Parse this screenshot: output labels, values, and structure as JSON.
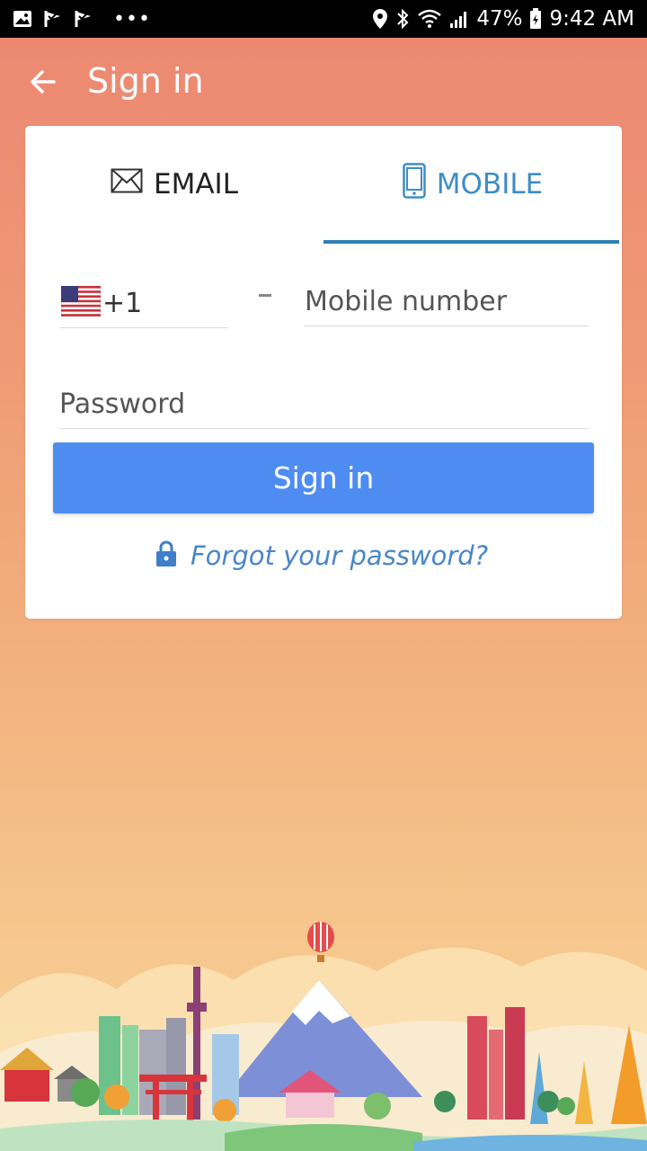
{
  "status_bar": {
    "battery": "47%",
    "time": "9:42 AM",
    "icons": [
      "image-icon",
      "check-flag-icon",
      "check-flag-icon",
      "more-dots-icon",
      "location-icon",
      "bluetooth-icon",
      "wifi-icon",
      "signal-icon",
      "battery-icon"
    ]
  },
  "app_bar": {
    "title": "Sign in",
    "back_icon": "arrow-left-icon"
  },
  "tabs": {
    "email": "EMAIL",
    "mobile": "MOBILE",
    "active": "mobile"
  },
  "form": {
    "country_code": "+1",
    "country_flag": "us-flag-icon",
    "mobile_placeholder": "Mobile number",
    "password_placeholder": "Password",
    "signin_label": "Sign in"
  },
  "forgot": {
    "label": "Forgot your password?",
    "icon": "lock-icon"
  },
  "colors": {
    "accent": "#4F8CF2",
    "tab_active": "#3F8DC4",
    "link": "#4A86C9",
    "background_top": "#EC8672",
    "background_bottom": "#F8D29A"
  }
}
